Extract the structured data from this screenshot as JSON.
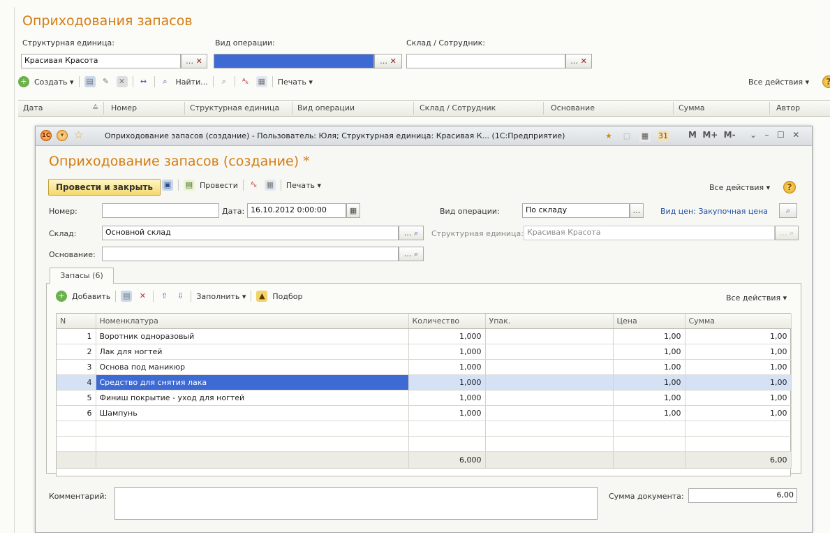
{
  "bg": {
    "title": "Оприходования запасов",
    "filters": {
      "unit_label": "Структурная единица:",
      "unit_value": "Красивая Красота",
      "optype_label": "Вид операции:",
      "optype_value": "",
      "warehouse_label": "Склад / Сотрудник:",
      "warehouse_value": ""
    },
    "toolbar": {
      "create": "Создать ▾",
      "find": "Найти...",
      "print": "Печать ▾",
      "all_actions": "Все действия ▾"
    },
    "columns": [
      "Дата",
      "Номер",
      "Структурная единица",
      "Вид операции",
      "Склад / Сотрудник",
      "Основание",
      "Сумма",
      "Автор"
    ]
  },
  "window": {
    "titlebar": "Оприходование запасов (создание) - Пользователь: Юля;  Структурная единица: Красивая К...  (1С:Предприятие)",
    "titlebar_buttons": {
      "m": "M",
      "mplus": "M+",
      "mminus": "M-"
    },
    "doc_title": "Оприходование запасов (создание)",
    "asterisk": "*",
    "toolbar": {
      "post_close": "Провести и закрыть",
      "post": "Провести",
      "print": "Печать ▾",
      "all_actions": "Все действия ▾",
      "help": "?"
    },
    "form": {
      "number_label": "Номер:",
      "number_value": "",
      "date_label": "Дата:",
      "date_value": "16.10.2012  0:00:00",
      "optype_label": "Вид операции:",
      "optype_value": "По складу",
      "price_type_link": "Вид цен: Закупочная цена",
      "warehouse_label": "Склад:",
      "warehouse_value": "Основной склад",
      "unit_label": "Структурная единица:",
      "unit_value": "Красивая Красота",
      "basis_label": "Основание:",
      "basis_value": ""
    },
    "tab_label": "Запасы (6)",
    "grid_toolbar": {
      "add": "Добавить",
      "fill": "Заполнить ▾",
      "pick": "Подбор",
      "all_actions": "Все действия ▾"
    },
    "grid": {
      "headers": [
        "N",
        "Номенклатура",
        "Количество",
        "Упак.",
        "Цена",
        "Сумма"
      ],
      "rows": [
        {
          "n": "1",
          "name": "Воротник одноразовый",
          "qty": "1,000",
          "pack": "",
          "price": "1,00",
          "sum": "1,00"
        },
        {
          "n": "2",
          "name": "Лак для ногтей",
          "qty": "1,000",
          "pack": "",
          "price": "1,00",
          "sum": "1,00"
        },
        {
          "n": "3",
          "name": "Основа под маникюр",
          "qty": "1,000",
          "pack": "",
          "price": "1,00",
          "sum": "1,00"
        },
        {
          "n": "4",
          "name": "Средство для снятия лака",
          "qty": "1,000",
          "pack": "",
          "price": "1,00",
          "sum": "1,00"
        },
        {
          "n": "5",
          "name": "Финиш покрытие - уход для ногтей",
          "qty": "1,000",
          "pack": "",
          "price": "1,00",
          "sum": "1,00"
        },
        {
          "n": "6",
          "name": "Шампунь",
          "qty": "1,000",
          "pack": "",
          "price": "1,00",
          "sum": "1,00"
        }
      ],
      "total_qty": "6,000",
      "total_sum": "6,00"
    },
    "comment_label": "Комментарий:",
    "doc_sum_label": "Сумма документа:",
    "doc_sum_value": "6,00"
  },
  "colors": {
    "accent_orange": "#d57c12",
    "selection_blue": "#3e6bd3",
    "row_highlight": "#d5e2f6",
    "link_blue": "#1f4fa8"
  }
}
